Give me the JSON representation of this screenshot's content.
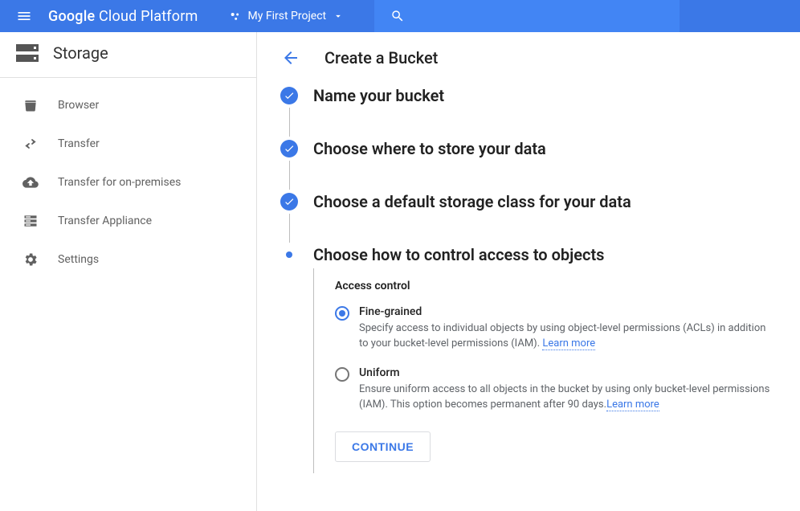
{
  "header": {
    "platform_name": "Google Cloud Platform",
    "project_name": "My First Project"
  },
  "sidebar": {
    "title": "Storage",
    "items": [
      {
        "label": "Browser",
        "icon": "bucket-icon"
      },
      {
        "label": "Transfer",
        "icon": "transfer-icon"
      },
      {
        "label": "Transfer for on-premises",
        "icon": "cloud-upload-icon"
      },
      {
        "label": "Transfer Appliance",
        "icon": "appliance-icon"
      },
      {
        "label": "Settings",
        "icon": "gear-icon"
      }
    ]
  },
  "page": {
    "title": "Create a Bucket"
  },
  "steps": [
    {
      "title": "Name your bucket",
      "state": "done"
    },
    {
      "title": "Choose where to store your data",
      "state": "done"
    },
    {
      "title": "Choose a default storage class for your data",
      "state": "done"
    },
    {
      "title": "Choose how to control access to objects",
      "state": "active"
    }
  ],
  "access_control": {
    "section_label": "Access control",
    "options": [
      {
        "id": "fine-grained",
        "label": "Fine-grained",
        "selected": true,
        "description": "Specify access to individual objects by using object-level permissions (ACLs) in addition to your bucket-level permissions (IAM).",
        "learn_more": "Learn more"
      },
      {
        "id": "uniform",
        "label": "Uniform",
        "selected": false,
        "description": "Ensure uniform access to all objects in the bucket by using only bucket-level permissions (IAM). This option becomes permanent after 90 days.",
        "learn_more": "Learn more"
      }
    ],
    "continue_label": "CONTINUE"
  }
}
